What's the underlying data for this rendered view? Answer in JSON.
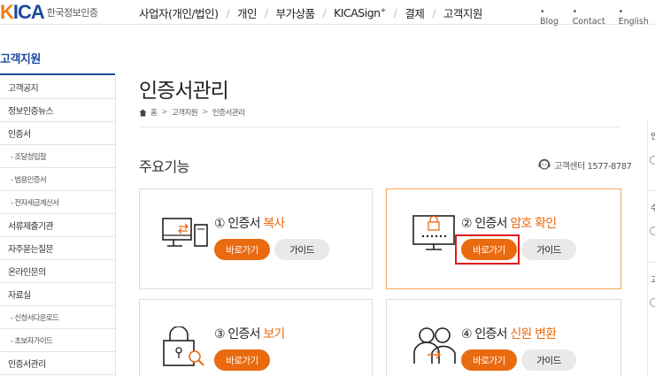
{
  "header": {
    "logo_mark_prefix": "K",
    "logo_mark_rest": "ICA",
    "logo_text": "한국정보인증",
    "nav": [
      "사업자(개인/법인)",
      "개인",
      "부가상품",
      "KICASign",
      "결제",
      "고객지원"
    ],
    "nav_sup": "+",
    "util": [
      "• Blog",
      "• Contact",
      "• English"
    ]
  },
  "sidebar": {
    "title": "고객지원",
    "items": [
      {
        "label": "고객공지",
        "sub": false
      },
      {
        "label": "정보인증뉴스",
        "sub": false
      },
      {
        "label": "인증서",
        "sub": false
      },
      {
        "label": "- 조달청입찰",
        "sub": true
      },
      {
        "label": "- 범용인증서",
        "sub": true
      },
      {
        "label": "- 전자세금계산서",
        "sub": true
      },
      {
        "label": "서류제출기관",
        "sub": false
      },
      {
        "label": "자주묻는질문",
        "sub": false
      },
      {
        "label": "온라인문의",
        "sub": false
      },
      {
        "label": "자료실",
        "sub": false
      },
      {
        "label": "- 신청서다운로드",
        "sub": true
      },
      {
        "label": "- 초보자가이드",
        "sub": true
      },
      {
        "label": "인증서관리",
        "sub": false
      }
    ]
  },
  "main": {
    "page_title": "인증서관리",
    "breadcrumb": [
      "홈",
      "고객지원",
      "인증서관리"
    ],
    "section_title": "주요기능",
    "call_center": "고객센터 1577-8787",
    "cards": [
      {
        "num": "①",
        "title_plain": "인증서",
        "title_hl": "복사",
        "go": "바로가기",
        "guide": "가이드"
      },
      {
        "num": "②",
        "title_plain": "인증서",
        "title_hl": "암호 확인",
        "go": "바로가기",
        "guide": "가이드"
      },
      {
        "num": "③",
        "title_plain": "인증서",
        "title_hl": "보기",
        "go": "바로가기",
        "guide": ""
      },
      {
        "num": "④",
        "title_plain": "인증서",
        "title_hl": "신원 변환",
        "go": "바로가기",
        "guide": "가이드"
      }
    ]
  },
  "right_panel": {
    "labels": [
      "인",
      "수",
      "고"
    ]
  },
  "colors": {
    "brand_blue": "#1b4a9c",
    "accent_orange": "#ea6a10",
    "highlight_red": "#e21a1a"
  }
}
